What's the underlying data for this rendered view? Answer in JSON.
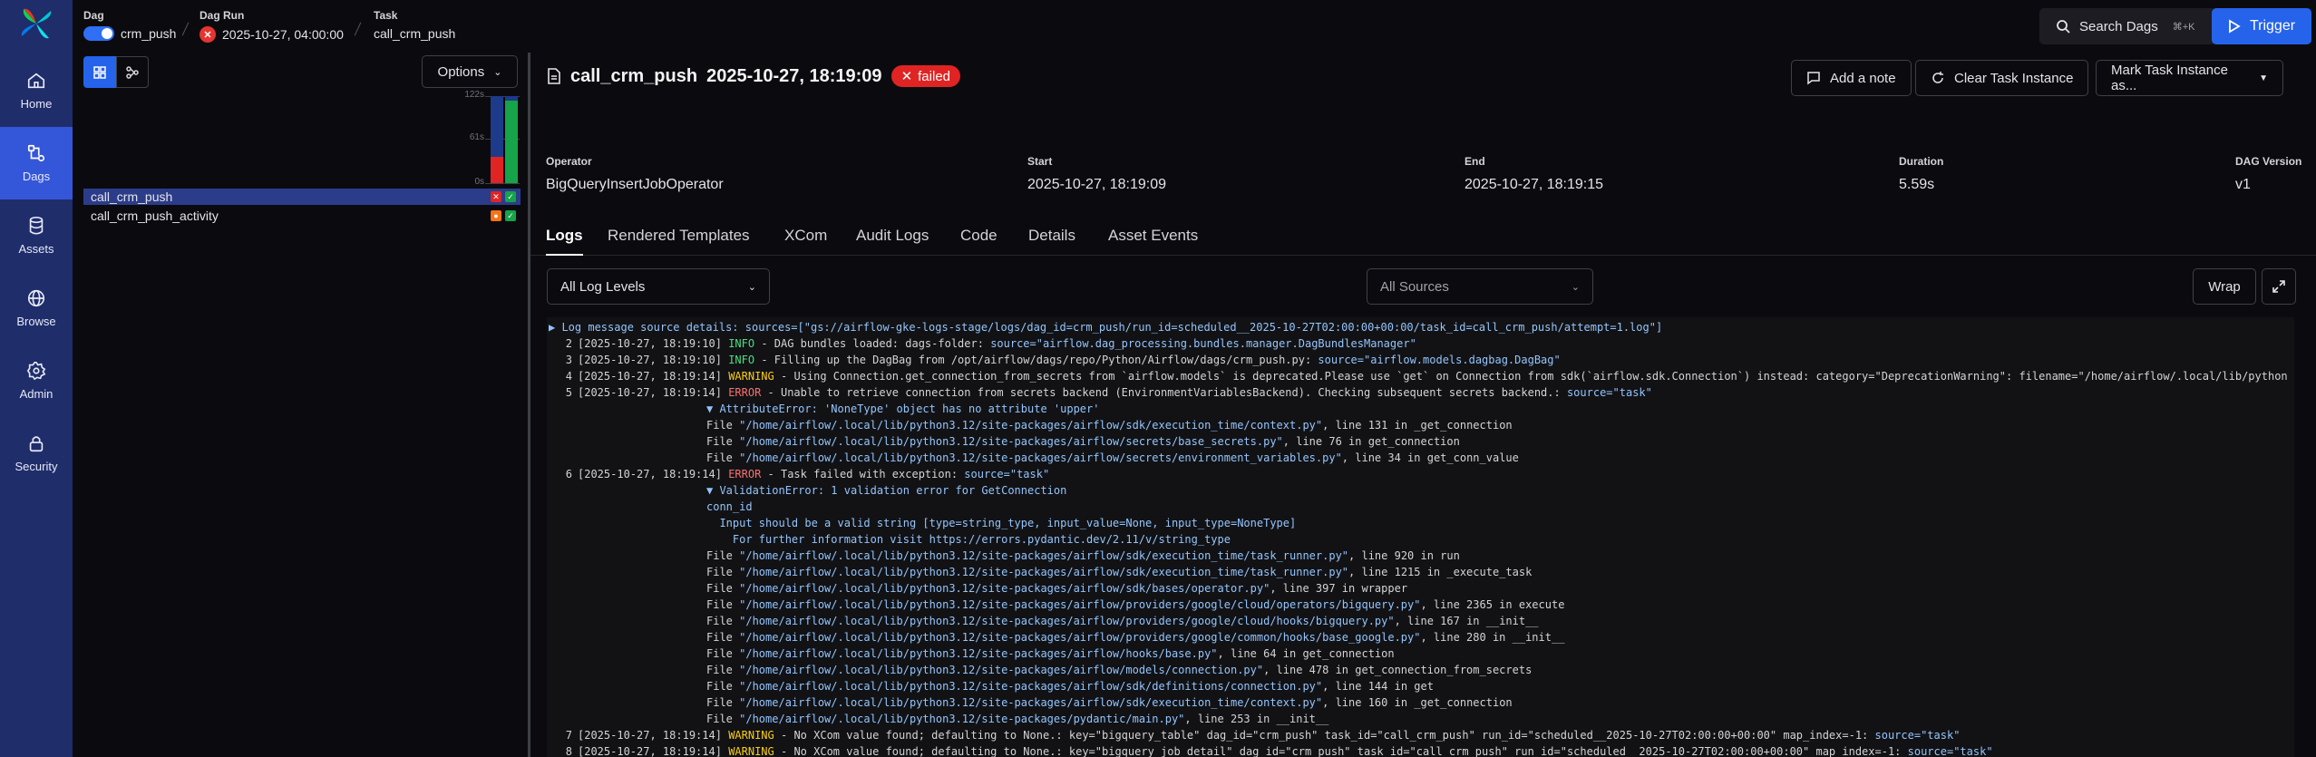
{
  "nav": {
    "items": [
      {
        "label": "Home",
        "icon": "home-icon"
      },
      {
        "label": "Dags",
        "icon": "dags-icon",
        "active": true
      },
      {
        "label": "Assets",
        "icon": "database-icon"
      },
      {
        "label": "Browse",
        "icon": "globe-icon"
      },
      {
        "label": "Admin",
        "icon": "gear-icon"
      },
      {
        "label": "Security",
        "icon": "lock-icon"
      }
    ]
  },
  "breadcrumb": {
    "dag_label": "Dag",
    "dag_value": "crm_push",
    "run_label": "Dag Run",
    "run_value": "2025-10-27, 04:00:00",
    "task_label": "Task",
    "task_value": "call_crm_push"
  },
  "search": {
    "label": "Search Dags",
    "shortcut": "⌘+K"
  },
  "trigger": {
    "label": "Trigger"
  },
  "grid": {
    "options_label": "Options",
    "y_ticks": [
      "122s",
      "61s",
      "0s"
    ],
    "tasks": [
      {
        "name": "call_crm_push",
        "selected": true,
        "states": [
          "failed",
          "success"
        ]
      },
      {
        "name": "call_crm_push_activity",
        "selected": false,
        "states": [
          "upstream_failed",
          "success"
        ]
      }
    ],
    "runs": [
      {
        "duration_fraction": 0.3,
        "state": "failed"
      },
      {
        "duration_fraction": 0.95,
        "state": "success"
      }
    ]
  },
  "task_instance": {
    "name": "call_crm_push",
    "date": "2025-10-27, 18:19:09",
    "state": "failed",
    "add_note": "Add a note",
    "clear": "Clear Task Instance",
    "mark": "Mark Task Instance as...",
    "meta": {
      "operator_label": "Operator",
      "operator": "BigQueryInsertJobOperator",
      "start_label": "Start",
      "start": "2025-10-27, 18:19:09",
      "end_label": "End",
      "end": "2025-10-27, 18:19:15",
      "duration_label": "Duration",
      "duration": "5.59s",
      "version_label": "DAG Version",
      "version": "v1"
    }
  },
  "tabs": [
    "Logs",
    "Rendered Templates",
    "XCom",
    "Audit Logs",
    "Code",
    "Details",
    "Asset Events"
  ],
  "log_controls": {
    "levels": "All Log Levels",
    "sources": "All Sources",
    "wrap": "Wrap"
  },
  "logs": {
    "source_details": "▶ Log message source details: sources=[\"gs://airflow-gke-logs-stage/logs/dag_id=crm_push/run_id=scheduled__2025-10-27T02:00:00+00:00/task_id=call_crm_push/attempt=1.log\"]",
    "lines": [
      {
        "n": "2",
        "ts": "[2025-10-27, 18:19:10]",
        "level": "INFO",
        "msg": " - DAG bundles loaded: dags-folder: ",
        "src": "source=\"airflow.dag_processing.bundles.manager.DagBundlesManager\""
      },
      {
        "n": "3",
        "ts": "[2025-10-27, 18:19:10]",
        "level": "INFO",
        "msg": " - Filling up the DagBag from /opt/airflow/dags/repo/Python/Airflow/dags/crm_push.py: ",
        "src": "source=\"airflow.models.dagbag.DagBag\""
      },
      {
        "n": "4",
        "ts": "[2025-10-27, 18:19:14]",
        "level": "WARNING",
        "msg": " - Using Connection.get_connection_from_secrets from `airflow.models` is deprecated.Please use `get` on Connection from sdk(`airflow.sdk.Connection`) instead: category=\"DeprecationWarning\": filename=\"/home/airflow/.local/lib/python",
        "src": ""
      },
      {
        "n": "5",
        "ts": "[2025-10-27, 18:19:14]",
        "level": "ERROR",
        "msg": " - Unable to retrieve connection from secrets backend (EnvironmentVariablesBackend). Checking subsequent secrets backend.: ",
        "src": "source=\"task\""
      }
    ],
    "trace1": {
      "error": "▼ AttributeError: 'NoneType' object has no attribute 'upper'",
      "frames": [
        {
          "path": "\"/home/airflow/.local/lib/python3.12/site-packages/airflow/sdk/execution_time/context.py\"",
          "tail": ", line 131 in _get_connection"
        },
        {
          "path": "\"/home/airflow/.local/lib/python3.12/site-packages/airflow/secrets/base_secrets.py\"",
          "tail": ", line 76 in get_connection"
        },
        {
          "path": "\"/home/airflow/.local/lib/python3.12/site-packages/airflow/secrets/environment_variables.py\"",
          "tail": ", line 34 in get_conn_value"
        }
      ]
    },
    "line6": {
      "n": "6",
      "ts": "[2025-10-27, 18:19:14]",
      "level": "ERROR",
      "msg": " - Task failed with exception: ",
      "src": "source=\"task\""
    },
    "trace2": {
      "error": "▼ ValidationError: 1 validation error for GetConnection",
      "detail1": "conn_id",
      "detail2": "  Input should be a valid string [type=string_type, input_value=None, input_type=NoneType]",
      "detail3": "    For further information visit https://errors.pydantic.dev/2.11/v/string_type",
      "frames": [
        {
          "path": "\"/home/airflow/.local/lib/python3.12/site-packages/airflow/sdk/execution_time/task_runner.py\"",
          "tail": ", line 920 in run"
        },
        {
          "path": "\"/home/airflow/.local/lib/python3.12/site-packages/airflow/sdk/execution_time/task_runner.py\"",
          "tail": ", line 1215 in _execute_task"
        },
        {
          "path": "\"/home/airflow/.local/lib/python3.12/site-packages/airflow/sdk/bases/operator.py\"",
          "tail": ", line 397 in wrapper"
        },
        {
          "path": "\"/home/airflow/.local/lib/python3.12/site-packages/airflow/providers/google/cloud/operators/bigquery.py\"",
          "tail": ", line 2365 in execute"
        },
        {
          "path": "\"/home/airflow/.local/lib/python3.12/site-packages/airflow/providers/google/cloud/hooks/bigquery.py\"",
          "tail": ", line 167 in __init__"
        },
        {
          "path": "\"/home/airflow/.local/lib/python3.12/site-packages/airflow/providers/google/common/hooks/base_google.py\"",
          "tail": ", line 280 in __init__"
        },
        {
          "path": "\"/home/airflow/.local/lib/python3.12/site-packages/airflow/hooks/base.py\"",
          "tail": ", line 64 in get_connection"
        },
        {
          "path": "\"/home/airflow/.local/lib/python3.12/site-packages/airflow/models/connection.py\"",
          "tail": ", line 478 in get_connection_from_secrets"
        },
        {
          "path": "\"/home/airflow/.local/lib/python3.12/site-packages/airflow/sdk/definitions/connection.py\"",
          "tail": ", line 144 in get"
        },
        {
          "path": "\"/home/airflow/.local/lib/python3.12/site-packages/airflow/sdk/execution_time/context.py\"",
          "tail": ", line 160 in _get_connection"
        },
        {
          "path": "\"/home/airflow/.local/lib/python3.12/site-packages/pydantic/main.py\"",
          "tail": ", line 253 in __init__"
        }
      ]
    },
    "tail_lines": [
      {
        "n": "7",
        "ts": "[2025-10-27, 18:19:14]",
        "level": "WARNING",
        "msg": " - No XCom value found; defaulting to None.: key=\"bigquery_table\" dag_id=\"crm_push\" task_id=\"call_crm_push\" run_id=\"scheduled__2025-10-27T02:00:00+00:00\" map_index=-1: ",
        "src": "source=\"task\""
      },
      {
        "n": "8",
        "ts": "[2025-10-27, 18:19:14]",
        "level": "WARNING",
        "msg": " - No XCom value found; defaulting to None.: key=\"bigquery_job_detail\" dag_id=\"crm_push\" task_id=\"call_crm_push\" run_id=\"scheduled__2025-10-27T02:00:00+00:00\" map_index=-1: ",
        "src": "source=\"task\""
      }
    ]
  },
  "colors": {
    "accent": "#2563eb",
    "nav_bg": "#1f2d6b",
    "failed": "#e02424",
    "success": "#16a34a",
    "upstream_failed": "#f97316"
  }
}
